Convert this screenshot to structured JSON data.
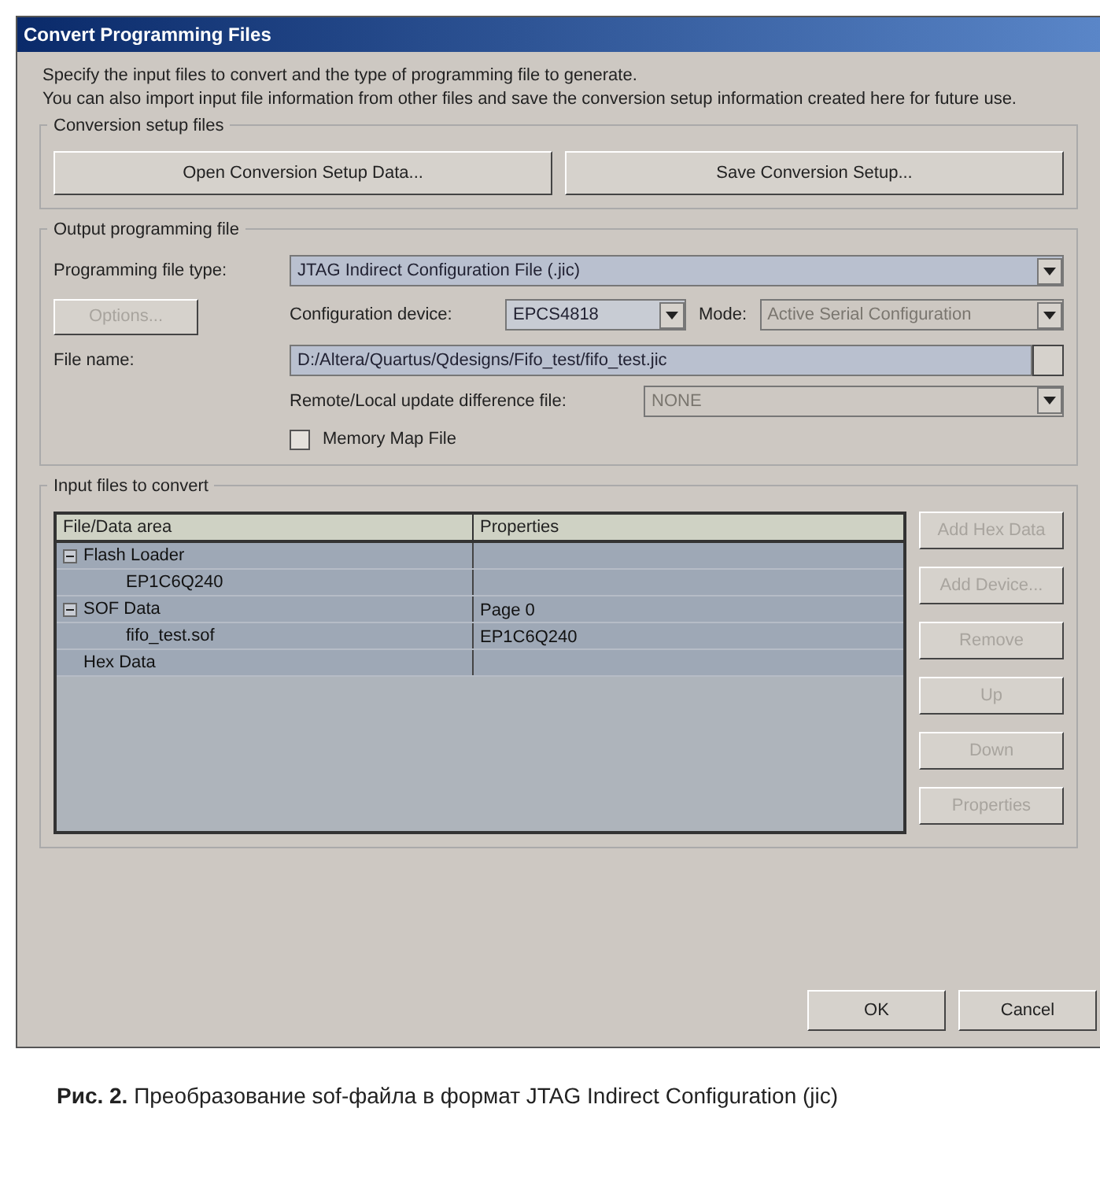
{
  "window": {
    "title": "Convert Programming Files"
  },
  "description": [
    "Specify the input files to convert and the type of programming file to generate.",
    "You can also import input file information from other files and save the conversion setup information created here for future use."
  ],
  "conversion_setup": {
    "title": "Conversion setup files",
    "buttons": [
      {
        "label": "Open Conversion Setup Data...",
        "disabled": false
      },
      {
        "label": "Save Conversion Setup...",
        "disabled": false
      }
    ]
  },
  "output": {
    "title": "Output programming file",
    "file_type": {
      "label": "Programming file type:",
      "value": "JTAG Indirect Configuration File (.jic)"
    },
    "options_button": {
      "label": "Options...",
      "disabled": true
    },
    "config_device": {
      "label": "Configuration device:",
      "value": "EPCS4818"
    },
    "mode": {
      "label": "Mode:",
      "value": "Active Serial Configuration",
      "disabled": true
    },
    "file_name": {
      "label": "File name:",
      "value": "D:/Altera/Quartus/Qdesigns/Fifo_test/fifo_test.jic"
    },
    "remote_file": {
      "label": "Remote/Local update difference file:",
      "value": "NONE",
      "disabled": true
    },
    "memory_map": {
      "label": "Memory Map File",
      "checked": false
    }
  },
  "input": {
    "title": "Input files to convert",
    "columns": [
      "File/Data area",
      "Properties"
    ],
    "tree": [
      {
        "label": "Flash Loader",
        "expanded": true,
        "children": [
          {
            "label": "EP1C6Q240"
          }
        ]
      },
      {
        "label": "SOF Data",
        "properties": "Page 0",
        "expanded": true,
        "children": [
          {
            "label": "fifo_test.sof",
            "properties": "EP1C6Q240"
          }
        ]
      },
      {
        "label": "Hex Data"
      }
    ],
    "buttons": [
      {
        "label": "Add Hex Data",
        "disabled": true
      },
      {
        "label": "Add Device...",
        "disabled": true
      },
      {
        "label": "Remove",
        "disabled": true
      },
      {
        "label": "Up",
        "disabled": true
      },
      {
        "label": "Down",
        "disabled": true
      },
      {
        "label": "Properties",
        "disabled": true
      }
    ]
  },
  "footer_buttons": [
    {
      "label": "OK"
    },
    {
      "label": "Cancel"
    }
  ],
  "caption": "**Рис. 2.** Преобразование sof-файла в формат JTAG Indirect Configuration (jic)"
}
